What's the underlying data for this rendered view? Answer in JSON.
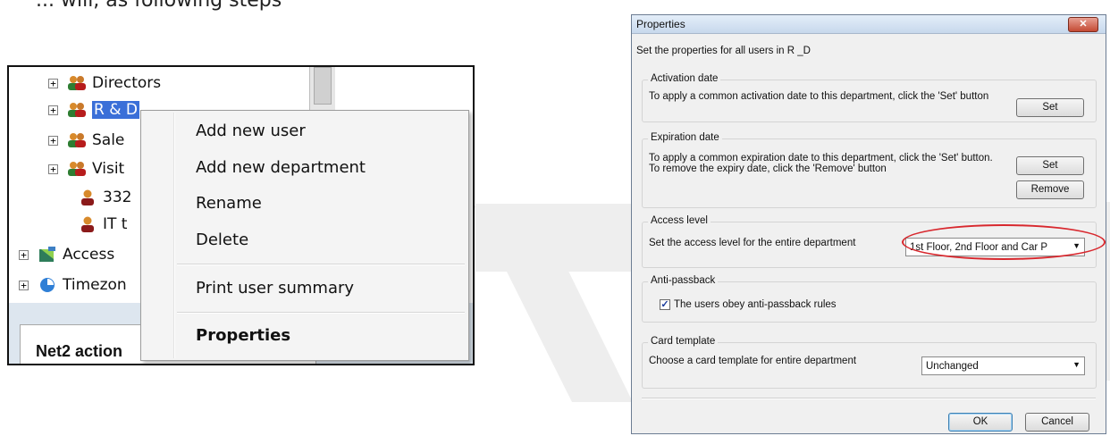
{
  "top_text": "... will, as following steps",
  "tree": {
    "items": [
      {
        "label": "Directors",
        "type": "department"
      },
      {
        "label": "R & D",
        "type": "department",
        "selected": true
      },
      {
        "label": "Sale",
        "type": "department"
      },
      {
        "label": "Visit",
        "type": "department"
      },
      {
        "label": "332",
        "type": "user"
      },
      {
        "label": "IT t",
        "type": "user"
      },
      {
        "label": "Access",
        "type": "access-levels"
      },
      {
        "label": "Timezon",
        "type": "timezones"
      }
    ],
    "actions_label": "Net2 action"
  },
  "context_menu": {
    "items": [
      "Add new user",
      "Add new department",
      "Rename",
      "Delete"
    ],
    "print_item": "Print user summary",
    "properties_item": "Properties"
  },
  "dialog": {
    "title": "Properties",
    "close_label": "✕",
    "intro": "Set the properties for all users in R _D",
    "activation": {
      "title": "Activation date",
      "text": "To apply a common activation date to this department, click the 'Set' button",
      "set_label": "Set"
    },
    "expiration": {
      "title": "Expiration date",
      "text1": "To apply a common expiration date to this department, click the 'Set' button.",
      "text2": "To remove the expiry date, click the 'Remove' button",
      "set_label": "Set",
      "remove_label": "Remove"
    },
    "access": {
      "title": "Access level",
      "text": "Set the access level for the entire department",
      "value": "1st Floor, 2nd Floor and Car P"
    },
    "antipassback": {
      "title": "Anti-passback",
      "checkbox_label": "The users obey anti-passback rules",
      "checked": true
    },
    "card": {
      "title": "Card template",
      "text": "Choose a card template for entire department",
      "value": "Unchanged"
    },
    "ok_label": "OK",
    "cancel_label": "Cancel"
  },
  "colors": {
    "selection": "#3a6fd8",
    "highlight_ellipse": "#d8282e",
    "close_button": "#c44a33"
  }
}
